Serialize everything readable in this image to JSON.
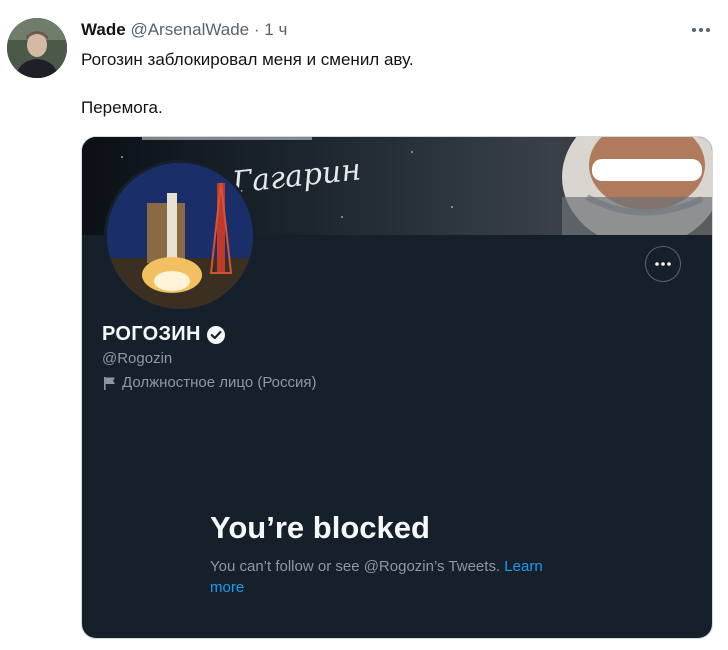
{
  "tweet": {
    "author_name": "Wade",
    "author_handle": "@ArsenalWade",
    "separator": "·",
    "time": "1 ч",
    "line1": "Рогозин заблокировал меня и сменил аву.",
    "line2": "Перемога."
  },
  "embedded_profile": {
    "display_name": "РОГОЗИН",
    "handle": "@Rogozin",
    "label": "Должностное лицо (Россия)",
    "blocked_title": "You’re blocked",
    "blocked_message": "You can’t follow or see @Rogozin’s Tweets.",
    "learn_more": "Learn more",
    "banner_signature": "Гагарин"
  },
  "colors": {
    "link": "#1d9bf0",
    "dark_bg": "#15202b",
    "muted": "#536471"
  }
}
